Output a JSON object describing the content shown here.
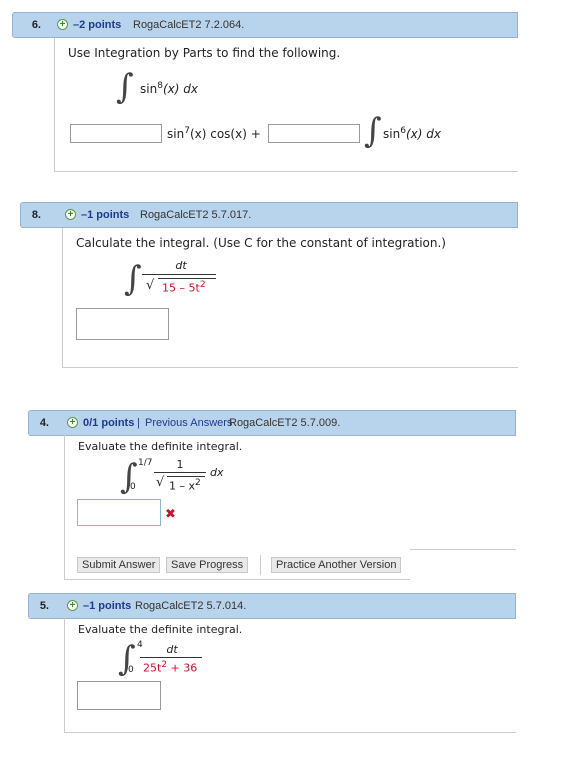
{
  "q6": {
    "number": "6.",
    "points": "–2 points",
    "source": "RogaCalcET2 7.2.064.",
    "prompt": "Use Integration by Parts to find the following.",
    "integrand_top": "sin",
    "exp_top": "8",
    "integrand_top_rest": "(x) dx",
    "middle_term": "sin",
    "middle_exp": "7",
    "middle_rest": "(x) cos(x) +",
    "last_term": "sin",
    "last_exp": "6",
    "last_rest": "(x) dx"
  },
  "q8": {
    "number": "8.",
    "points": "–1 points",
    "source": "RogaCalcET2 5.7.017.",
    "prompt": "Calculate the integral. (Use C for the constant of integration.)",
    "numerator": "dt",
    "denominator": "15 – 5t",
    "denominator_exp": "2"
  },
  "q4": {
    "number": "4.",
    "points": "0/1 points",
    "separator": "|",
    "previous_answers": "Previous Answers",
    "source": "RogaCalcET2 5.7.009.",
    "prompt": "Evaluate the definite integral.",
    "upper_limit": "1/7",
    "lower_limit": "0",
    "numerator": "1",
    "denominator": "1 – x",
    "denominator_exp": "2",
    "dx": "dx",
    "wrong_mark": "✖",
    "buttons": {
      "submit": "Submit Answer",
      "save": "Save Progress",
      "practice": "Practice Another Version"
    }
  },
  "q5": {
    "number": "5.",
    "points": "–1 points",
    "source": "RogaCalcET2 5.7.014.",
    "prompt": "Evaluate the definite integral.",
    "upper_limit": "4",
    "lower_limit": "0",
    "numerator": "dt",
    "denominator": "25t",
    "denominator_exp": "2",
    "denominator_rest": "+ 36"
  },
  "colors": {
    "header_bg": "#b8d4ec",
    "points_text": "#1f3a8a",
    "red": "#c8102e"
  }
}
